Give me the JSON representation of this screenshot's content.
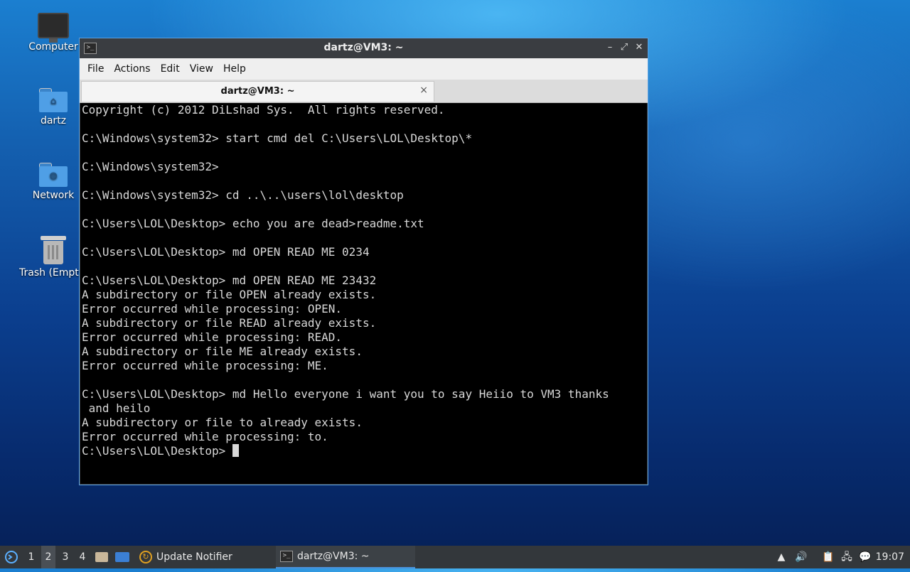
{
  "desktop": {
    "icons": [
      {
        "label": "Computer"
      },
      {
        "label": "dartz"
      },
      {
        "label": "Network"
      },
      {
        "label": "Trash (Empty)"
      }
    ]
  },
  "window": {
    "title": "dartz@VM3: ~",
    "controls": {
      "minimize": "–",
      "maximize": "⤢",
      "close": "✕"
    },
    "menu": [
      "File",
      "Actions",
      "Edit",
      "View",
      "Help"
    ],
    "tab": {
      "title": "dartz@VM3: ~",
      "close": "×"
    },
    "terminal_lines": [
      "Copyright (c) 2012 DiLshad Sys.  All rights reserved.",
      "",
      "C:\\Windows\\system32> start cmd del C:\\Users\\LOL\\Desktop\\*",
      "",
      "C:\\Windows\\system32>",
      "",
      "C:\\Windows\\system32> cd ..\\..\\users\\lol\\desktop",
      "",
      "C:\\Users\\LOL\\Desktop> echo you are dead>readme.txt",
      "",
      "C:\\Users\\LOL\\Desktop> md OPEN READ ME 0234",
      "",
      "C:\\Users\\LOL\\Desktop> md OPEN READ ME 23432",
      "A subdirectory or file OPEN already exists.",
      "Error occurred while processing: OPEN.",
      "A subdirectory or file READ already exists.",
      "Error occurred while processing: READ.",
      "A subdirectory or file ME already exists.",
      "Error occurred while processing: ME.",
      "",
      "C:\\Users\\LOL\\Desktop> md Hello everyone i want you to say Heiio to VM3 thanks",
      " and heilo",
      "A subdirectory or file to already exists.",
      "Error occurred while processing: to."
    ],
    "prompt": "C:\\Users\\LOL\\Desktop> "
  },
  "taskbar": {
    "workspaces": [
      "1",
      "2",
      "3",
      "4"
    ],
    "active_workspace": "2",
    "update_notifier": "Update Notifier",
    "terminal_task": "dartz@VM3: ~",
    "clock": "19:07"
  },
  "colors": {
    "accent": "#4a90d9",
    "terminal_bg": "#000000",
    "terminal_fg": "#d8d8d8"
  }
}
